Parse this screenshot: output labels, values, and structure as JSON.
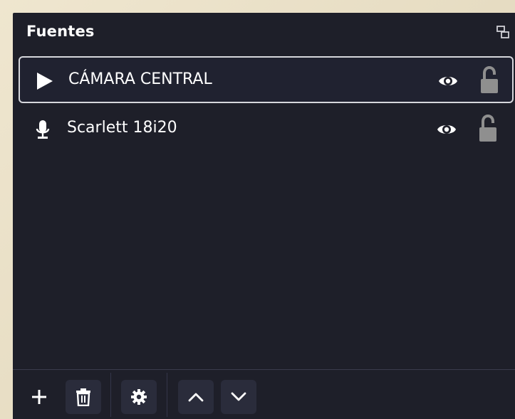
{
  "dock": {
    "title": "Fuentes",
    "float_icon": "undock-icon"
  },
  "sources": [
    {
      "label": "CÁMARA CENTRAL",
      "type_icon": "play-icon",
      "selected": true,
      "visible": true,
      "locked": false
    },
    {
      "label": "Scarlett 18i20",
      "type_icon": "microphone-icon",
      "selected": false,
      "visible": true,
      "locked": false
    }
  ],
  "toolbar": {
    "buttons": [
      {
        "name": "add-source-button",
        "icon": "plus-icon"
      },
      {
        "name": "remove-source-button",
        "icon": "trash-icon"
      },
      {
        "name": "source-properties-button",
        "icon": "gear-icon"
      },
      {
        "name": "move-up-button",
        "icon": "chevron-up-icon"
      },
      {
        "name": "move-down-button",
        "icon": "chevron-down-icon"
      }
    ]
  },
  "colors": {
    "panel_bg": "#1e1f29",
    "selected_border": "#d6d7dc",
    "text": "#ffffff",
    "lock_icon": "#8a8a8a",
    "button_bg": "#2a2c3b"
  }
}
